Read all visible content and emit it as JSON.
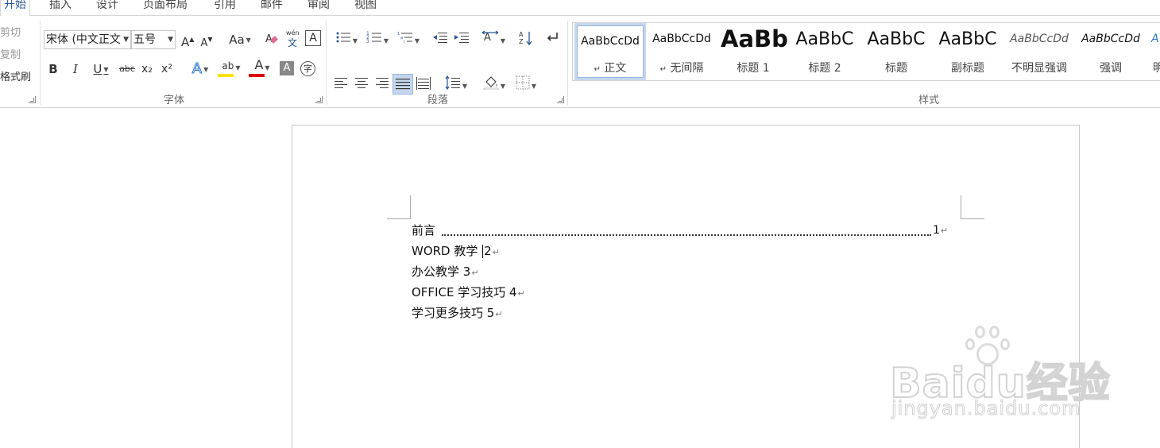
{
  "tabs": [
    "开始",
    "插入",
    "设计",
    "页面布局",
    "引用",
    "邮件",
    "审阅",
    "视图"
  ],
  "clipboard": {
    "cut": "剪切",
    "copy": "复制",
    "format_painter": "格式刷"
  },
  "font": {
    "group_label": "字体",
    "font_name": "宋体 (中文正文",
    "font_size": "五号",
    "grow_label": "A",
    "shrink_label": "A",
    "case_label": "Aa",
    "phonetic_label": "wén",
    "phonetic_char": "文",
    "border_char": "A",
    "bold": "B",
    "italic": "I",
    "underline": "U",
    "strikethrough": "abc",
    "subscript": "x₂",
    "superscript": "x²",
    "effects": "A",
    "highlight": "ab",
    "font_color": "A",
    "char_shading": "A",
    "enclose": "字",
    "highlight_color": "#ffe100",
    "font_color_value": "#e00000"
  },
  "paragraph": {
    "group_label": "段落"
  },
  "styles": {
    "group_label": "样式",
    "items": [
      {
        "sample": "AaBbCcDd",
        "name": "正文",
        "para": "↵"
      },
      {
        "sample": "AaBbCcDd",
        "name": "无间隔",
        "para": "↵"
      },
      {
        "sample": "AaBb",
        "name": "标题 1",
        "para": ""
      },
      {
        "sample": "AaBbC",
        "name": "标题 2",
        "para": ""
      },
      {
        "sample": "AaBbC",
        "name": "标题",
        "para": ""
      },
      {
        "sample": "AaBbC",
        "name": "副标题",
        "para": ""
      },
      {
        "sample": "AaBbCcDd",
        "name": "不明显强调",
        "para": ""
      },
      {
        "sample": "AaBbCcDd",
        "name": "强调",
        "para": ""
      },
      {
        "sample": "A",
        "name": "明",
        "para": ""
      }
    ]
  },
  "document": {
    "toc_first_title": "前言",
    "toc_first_page": "1",
    "para_mark": "↵",
    "lines": [
      {
        "before_cursor": "WORD 教学 ",
        "after_cursor": "2"
      },
      {
        "text": "办公教学 3"
      },
      {
        "text": "OFFICE 学习技巧 4"
      },
      {
        "text": "学习更多技巧 5"
      }
    ]
  },
  "watermark": {
    "brand": "Baidu经验",
    "url": "jingyan.baidu.com"
  }
}
